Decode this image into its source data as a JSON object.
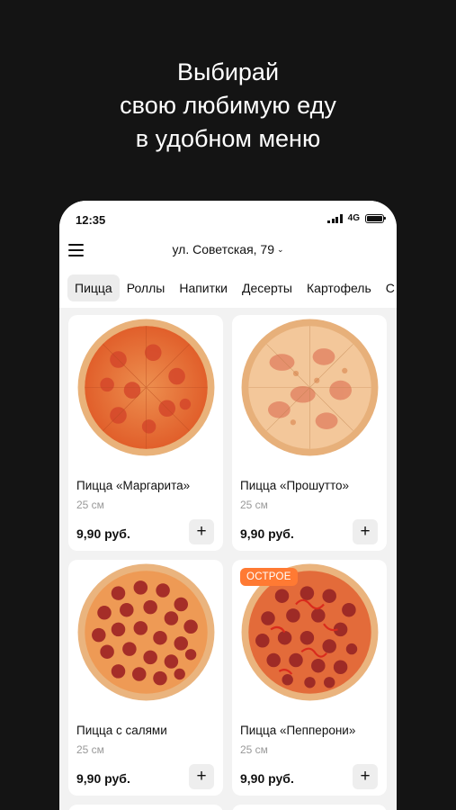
{
  "promo": {
    "line1": "Выбирай",
    "line2": "свою любимую еду",
    "line3": "в удобном меню"
  },
  "status": {
    "time": "12:35",
    "network": "4G"
  },
  "header": {
    "menu_icon": "hamburger-icon",
    "address": "ул. Советская, 79",
    "address_icon": "chevron-down-icon"
  },
  "tabs": [
    {
      "label": "Пицца",
      "active": true
    },
    {
      "label": "Роллы",
      "active": false
    },
    {
      "label": "Напитки",
      "active": false
    },
    {
      "label": "Десерты",
      "active": false
    },
    {
      "label": "Картофель",
      "active": false
    },
    {
      "label": "С",
      "active": false
    }
  ],
  "products": [
    {
      "name": "Пицца «Маргарита»",
      "size": "25 см",
      "price": "9,90 руб.",
      "add": "+",
      "badge": ""
    },
    {
      "name": "Пицца «Прошутто»",
      "size": "25 см",
      "price": "9,90 руб.",
      "add": "+",
      "badge": ""
    },
    {
      "name": "Пицца с салями",
      "size": "25 см",
      "price": "9,90 руб.",
      "add": "+",
      "badge": ""
    },
    {
      "name": "Пицца «Пепперони»",
      "size": "25 см",
      "price": "9,90 руб.",
      "add": "+",
      "badge": "ОСТРОЕ"
    }
  ],
  "colors": {
    "background": "#141414",
    "badge": "#ff7a33",
    "crust": "#e9b27a",
    "sauce": "#e2542a",
    "cheese": "#f0a060",
    "salami": "#b6332b"
  }
}
